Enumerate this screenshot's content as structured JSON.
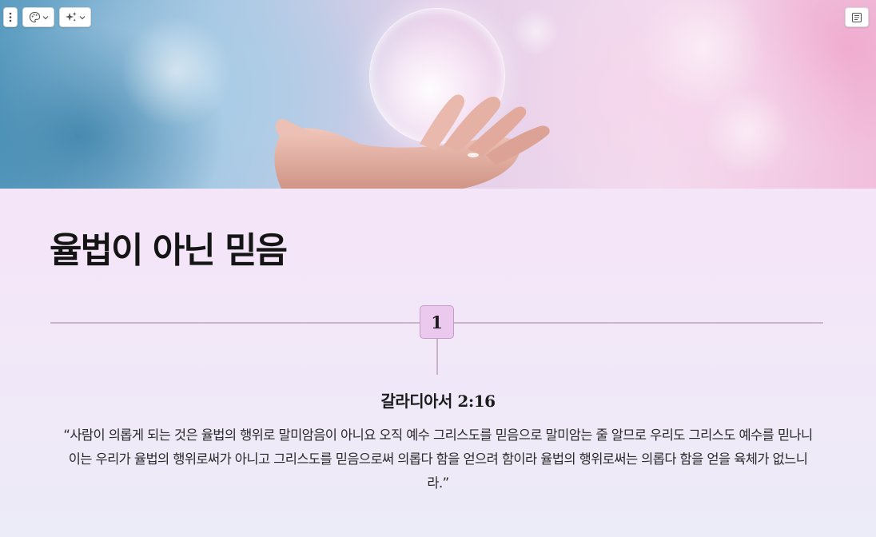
{
  "hero": {
    "image_description_icon": "hand-with-bubble-image"
  },
  "toolbar": {
    "menu_icon": "more-vertical-icon",
    "theme_icon": "palette-icon",
    "ai_icon": "sparkle-icon",
    "dropdown_icon": "chevron-down-icon",
    "notes_icon": "notes-icon"
  },
  "slide": {
    "title": "율법이 아닌 믿음",
    "step_number": "1",
    "reference": "갈라디아서 2:16",
    "verse": "“사람이 의롭게 되는 것은 율법의 행위로 말미암음이 아니요 오직 예수 그리스도를 믿음으로 말미암는 줄 알므로 우리도 그리스도 예수를 믿나니 이는 우리가 율법의 행위로써가 아니고 그리스도를 믿음으로써 의롭다 함을 얻으려 함이라 율법의 행위로써는 의롭다 함을 얻을 육체가 없느니라.”"
  },
  "colors": {
    "accent_box": "#ebc9ee",
    "accent_border": "#c49dc8",
    "line": "#cdb2cc"
  }
}
